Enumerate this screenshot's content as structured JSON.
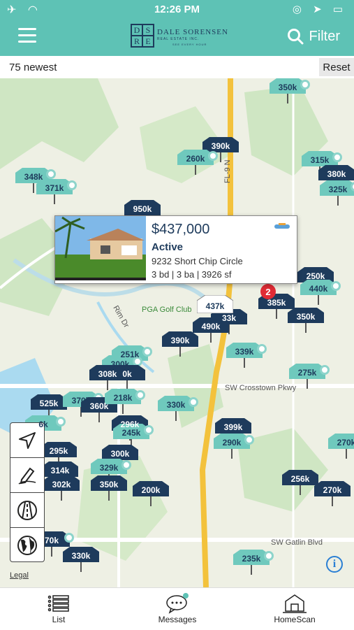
{
  "status_bar": {
    "time": "12:26 PM"
  },
  "header": {
    "logo_letters": [
      "D",
      "S",
      "R",
      "E"
    ],
    "logo_name": "DALE SORENSEN",
    "logo_sub": "REAL ESTATE INC.",
    "logo_sub2": "SEE EVERY HOUR",
    "filter_label": "Filter"
  },
  "subbar": {
    "count_label": "75 newest",
    "reset_label": "Reset"
  },
  "map": {
    "road_labels": [
      "FL-9 N",
      "SW Crosstown Pkwy",
      "SW Gatlin Blvd",
      "Rim Dr",
      "PGA Golf Club"
    ],
    "cluster_count": "2",
    "selected_pin": "437k",
    "pins": [
      {
        "label": "350k",
        "style": "teal"
      },
      {
        "label": "390k",
        "style": "dark"
      },
      {
        "label": "260k",
        "style": "teal"
      },
      {
        "label": "315k",
        "style": "teal"
      },
      {
        "label": "380k",
        "style": "dark"
      },
      {
        "label": "325k",
        "style": "teal"
      },
      {
        "label": "348k",
        "style": "teal"
      },
      {
        "label": "371k",
        "style": "teal"
      },
      {
        "label": "950k",
        "style": "dark"
      },
      {
        "label": "250k",
        "style": "dark"
      },
      {
        "label": "440k",
        "style": "teal"
      },
      {
        "label": "385k",
        "style": "dark"
      },
      {
        "label": "350k",
        "style": "dark"
      },
      {
        "label": "33k",
        "style": "dark"
      },
      {
        "label": "490k",
        "style": "dark"
      },
      {
        "label": "390k",
        "style": "dark"
      },
      {
        "label": "251k",
        "style": "teal"
      },
      {
        "label": "339k",
        "style": "teal"
      },
      {
        "label": "300k",
        "style": "teal"
      },
      {
        "label": "308k",
        "style": "dark"
      },
      {
        "label": "0k",
        "style": "dark"
      },
      {
        "label": "275k",
        "style": "teal"
      },
      {
        "label": "525k",
        "style": "dark"
      },
      {
        "label": "370k",
        "style": "teal"
      },
      {
        "label": "360k",
        "style": "dark"
      },
      {
        "label": "218k",
        "style": "teal"
      },
      {
        "label": "330k",
        "style": "teal"
      },
      {
        "label": "6k",
        "style": "teal"
      },
      {
        "label": "296k",
        "style": "dark"
      },
      {
        "label": "245k",
        "style": "teal"
      },
      {
        "label": "399k",
        "style": "dark"
      },
      {
        "label": "290k",
        "style": "teal"
      },
      {
        "label": "270k",
        "style": "teal"
      },
      {
        "label": "295k",
        "style": "dark"
      },
      {
        "label": "300k",
        "style": "dark"
      },
      {
        "label": "314k",
        "style": "dark"
      },
      {
        "label": "329k",
        "style": "teal"
      },
      {
        "label": "302k",
        "style": "dark"
      },
      {
        "label": "350k",
        "style": "dark"
      },
      {
        "label": "200k",
        "style": "dark"
      },
      {
        "label": "256k",
        "style": "dark"
      },
      {
        "label": "270k",
        "style": "dark"
      },
      {
        "label": "70k",
        "style": "dark"
      },
      {
        "label": "330k",
        "style": "dark"
      },
      {
        "label": "235k",
        "style": "teal"
      }
    ],
    "popup": {
      "price": "$437,000",
      "status": "Active",
      "address": "9232 Short Chip Circle",
      "specs": "3 bd | 3 ba | 3926 sf"
    },
    "legal_label": "Legal"
  },
  "tabs": [
    {
      "label": "List",
      "icon": "list-icon"
    },
    {
      "label": "Messages",
      "icon": "chat-icon"
    },
    {
      "label": "HomeScan",
      "icon": "house-scan-icon"
    }
  ],
  "colors": {
    "accent": "#5ec2b5",
    "pin_dark": "#1e3b5c",
    "pin_teal": "#6fc9bd",
    "cluster": "#e02b35"
  }
}
